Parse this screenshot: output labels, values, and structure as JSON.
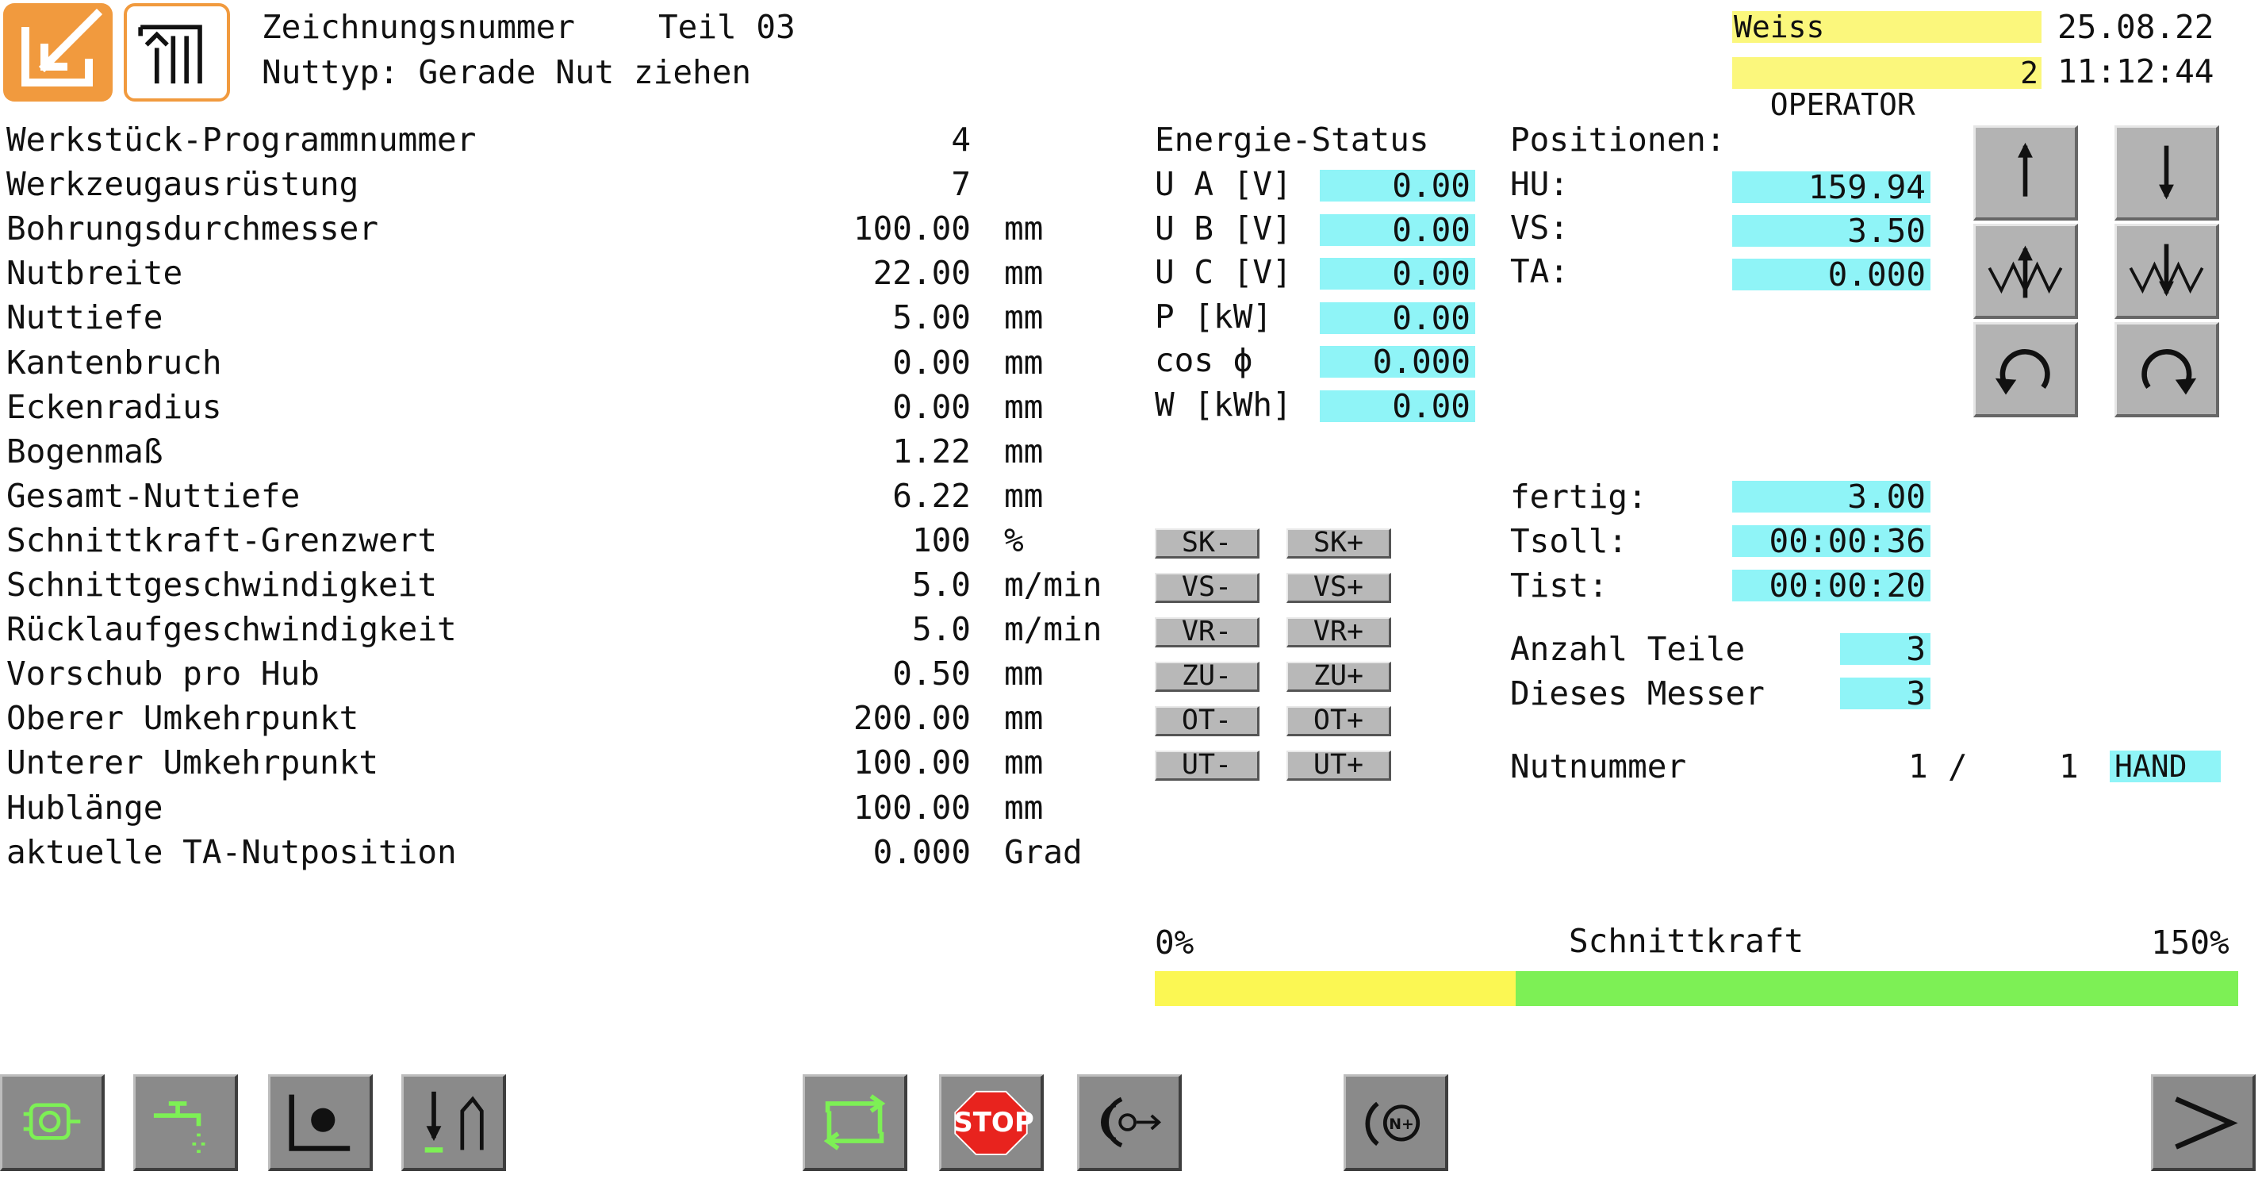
{
  "header": {
    "drawing_label": "Zeichnungsnummer",
    "part_label": "Teil 03",
    "nut_type": "Nuttyp: Gerade Nut ziehen",
    "user_name": "Weiss",
    "role": "OPERATOR",
    "role_level": "2",
    "date": "25.08.22",
    "time": "11:12:44"
  },
  "params": [
    {
      "label": "Werkstück-Programmnummer",
      "value": "4",
      "unit": ""
    },
    {
      "label": "Werkzeugausrüstung",
      "value": "7",
      "unit": ""
    },
    {
      "label": "Bohrungsdurchmesser",
      "value": "100.00",
      "unit": "mm"
    },
    {
      "label": "Nutbreite",
      "value": "22.00",
      "unit": "mm"
    },
    {
      "label": "Nuttiefe",
      "value": "5.00",
      "unit": "mm"
    },
    {
      "label": "Kantenbruch",
      "value": "0.00",
      "unit": "mm"
    },
    {
      "label": "Eckenradius",
      "value": "0.00",
      "unit": "mm"
    },
    {
      "label": "Bogenmaß",
      "value": "1.22",
      "unit": "mm"
    },
    {
      "label": "Gesamt-Nuttiefe",
      "value": "6.22",
      "unit": "mm"
    },
    {
      "label": "Schnittkraft-Grenzwert",
      "value": "100",
      "unit": "%"
    },
    {
      "label": "Schnittgeschwindigkeit",
      "value": "5.0",
      "unit": "m/min"
    },
    {
      "label": "Rücklaufgeschwindigkeit",
      "value": "5.0",
      "unit": "m/min"
    },
    {
      "label": "Vorschub pro Hub",
      "value": "0.50",
      "unit": "mm"
    },
    {
      "label": "Oberer Umkehrpunkt",
      "value": "200.00",
      "unit": "mm"
    },
    {
      "label": "Unterer Umkehrpunkt",
      "value": "100.00",
      "unit": "mm"
    },
    {
      "label": "Hublänge",
      "value": "100.00",
      "unit": "mm"
    },
    {
      "label": "aktuelle TA-Nutposition",
      "value": "0.000",
      "unit": "Grad"
    }
  ],
  "energy": {
    "title": "Energie-Status",
    "rows": [
      {
        "label": "U A [V]",
        "value": "0.00"
      },
      {
        "label": "U B [V]",
        "value": "0.00"
      },
      {
        "label": "U C [V]",
        "value": "0.00"
      },
      {
        "label": "P [kW]",
        "value": "0.00"
      },
      {
        "label": "cos ϕ",
        "value": "0.000"
      },
      {
        "label": "W [kWh]",
        "value": "0.00"
      }
    ]
  },
  "adjust_buttons": [
    {
      "minus": "SK-",
      "plus": "SK+"
    },
    {
      "minus": "VS-",
      "plus": "VS+"
    },
    {
      "minus": "VR-",
      "plus": "VR+"
    },
    {
      "minus": "ZU-",
      "plus": "ZU+"
    },
    {
      "minus": "OT-",
      "plus": "OT+"
    },
    {
      "minus": "UT-",
      "plus": "UT+"
    }
  ],
  "positions": {
    "title": "Positionen:",
    "rows": [
      {
        "label": "HU:",
        "value": "159.94"
      },
      {
        "label": "VS:",
        "value": "3.50"
      },
      {
        "label": "TA:",
        "value": "0.000"
      }
    ]
  },
  "status": {
    "fertig_label": "fertig:",
    "fertig_value": "3.00",
    "tsoll_label": "Tsoll:",
    "tsoll_value": "00:00:36",
    "tist_label": "Tist:",
    "tist_value": "00:00:20",
    "anzahl_label": "Anzahl Teile",
    "anzahl_value": "3",
    "messer_label": "Dieses Messer",
    "messer_value": "3",
    "nut_label": "Nutnummer",
    "nut_current": "1",
    "nut_sep": "/",
    "nut_total": "1",
    "mode": "HAND"
  },
  "force_bar": {
    "min_label": "0%",
    "title": "Schnittkraft",
    "max_label": "150%",
    "yellow_fraction": 0.333,
    "colors": {
      "low": "#fbf753",
      "high": "#7df055"
    }
  },
  "toolbar": {
    "stop_label": "STOP"
  },
  "icons": [
    "edit-app-icon",
    "machine-app-icon",
    "arrow-up-icon",
    "arrow-down-icon",
    "tool-up-icon",
    "tool-down-icon",
    "rotate-left-icon",
    "rotate-right-icon",
    "motor-icon",
    "coolant-tap-icon",
    "chart-point-icon",
    "tool-lower-icon",
    "cycle-icon",
    "stop-icon",
    "spindle-icon",
    "counter-icon",
    "next-arrow-icon"
  ]
}
